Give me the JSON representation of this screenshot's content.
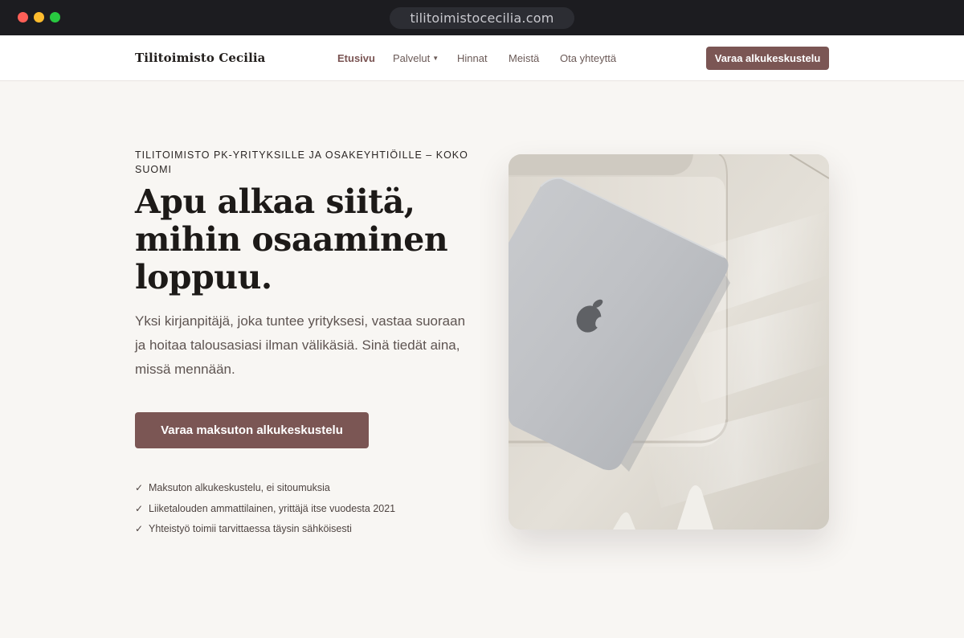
{
  "browser": {
    "url": "tilitoimistocecilia.com"
  },
  "nav": {
    "brand": "Tilitoimisto Cecilia",
    "links": [
      {
        "label": "Etusivu"
      },
      {
        "label": "Palvelut"
      },
      {
        "label": "Hinnat"
      },
      {
        "label": "Meistä"
      },
      {
        "label": "Ota yhteyttä"
      }
    ],
    "cta": "Varaa alkukeskustelu"
  },
  "hero": {
    "eyebrow": "TILITOIMISTO PK-YRITYKSILLE JA OSAKEYHTIÖILLE – KOKO SUOMI",
    "headline": "Apu alkaa siitä, mihin osaaminen loppuu.",
    "lead": "Yksi kirjanpitäjä, joka tuntee yrityksesi, vastaa suoraan ja hoitaa talousasiasi ilman välikäsiä. Sinä tiedät aina, missä mennään.",
    "cta": "Varaa maksuton alkukeskustelu",
    "checks": [
      "Maksuton alkukeskustelu, ei sitoumuksia",
      "Liiketalouden ammattilainen, yrittäjä itse vuodesta 2021",
      "Yhteistyö toimii tarvittaessa täysin sähköisesti"
    ]
  },
  "icons": {
    "check": "check-icon",
    "caret": "chevron-down-icon"
  },
  "colors": {
    "accent": "#7b5654",
    "background": "#f8f6f3",
    "text": "#1d1a18"
  }
}
